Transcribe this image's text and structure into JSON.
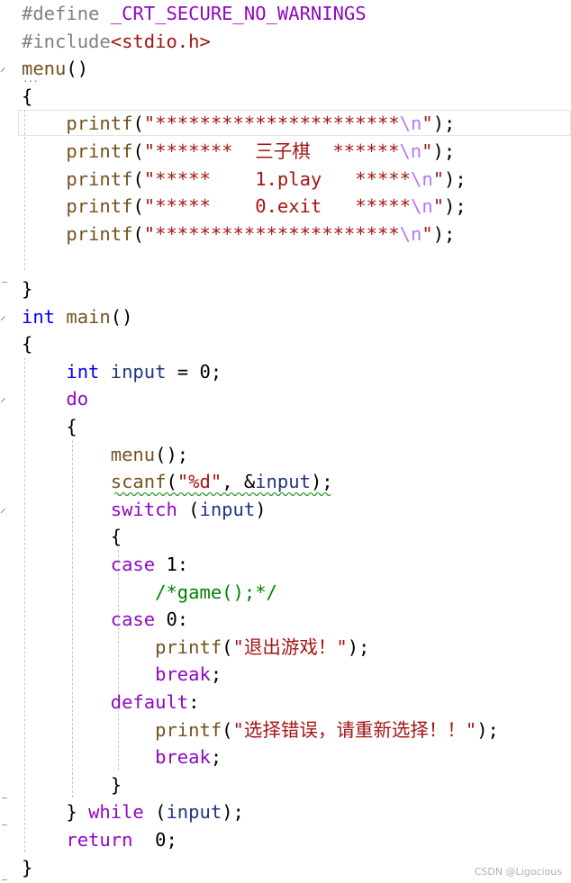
{
  "editor": {
    "colors": {
      "macro": "#808080",
      "keyword": "#0000ff",
      "control": "#8f08c4",
      "function": "#74531f",
      "string": "#a31515",
      "escape": "#b776fb",
      "comment": "#008000",
      "variable": "#1f377f",
      "default": "#000000"
    },
    "lines": [
      [
        {
          "t": "#define ",
          "c": "macro"
        },
        {
          "t": "_CRT_SECURE_NO_WARNINGS",
          "c": "control"
        }
      ],
      [
        {
          "t": "#include",
          "c": "macro"
        },
        {
          "t": "<stdio.h>",
          "c": "string"
        }
      ],
      [
        {
          "t": "menu",
          "c": "function"
        },
        {
          "t": "()",
          "c": "default"
        }
      ],
      [
        {
          "t": "{",
          "c": "default"
        }
      ],
      [
        {
          "t": "    ",
          "c": "default"
        },
        {
          "t": "printf",
          "c": "function"
        },
        {
          "t": "(",
          "c": "default"
        },
        {
          "t": "\"**********************",
          "c": "string"
        },
        {
          "t": "\\n",
          "c": "escape"
        },
        {
          "t": "\"",
          "c": "string"
        },
        {
          "t": ");",
          "c": "default"
        }
      ],
      [
        {
          "t": "    ",
          "c": "default"
        },
        {
          "t": "printf",
          "c": "function"
        },
        {
          "t": "(",
          "c": "default"
        },
        {
          "t": "\"*******  三子棋  ******",
          "c": "string"
        },
        {
          "t": "\\n",
          "c": "escape"
        },
        {
          "t": "\"",
          "c": "string"
        },
        {
          "t": ");",
          "c": "default"
        }
      ],
      [
        {
          "t": "    ",
          "c": "default"
        },
        {
          "t": "printf",
          "c": "function"
        },
        {
          "t": "(",
          "c": "default"
        },
        {
          "t": "\"*****    1.play   *****",
          "c": "string"
        },
        {
          "t": "\\n",
          "c": "escape"
        },
        {
          "t": "\"",
          "c": "string"
        },
        {
          "t": ");",
          "c": "default"
        }
      ],
      [
        {
          "t": "    ",
          "c": "default"
        },
        {
          "t": "printf",
          "c": "function"
        },
        {
          "t": "(",
          "c": "default"
        },
        {
          "t": "\"*****    0.exit   *****",
          "c": "string"
        },
        {
          "t": "\\n",
          "c": "escape"
        },
        {
          "t": "\"",
          "c": "string"
        },
        {
          "t": ");",
          "c": "default"
        }
      ],
      [
        {
          "t": "    ",
          "c": "default"
        },
        {
          "t": "printf",
          "c": "function"
        },
        {
          "t": "(",
          "c": "default"
        },
        {
          "t": "\"**********************",
          "c": "string"
        },
        {
          "t": "\\n",
          "c": "escape"
        },
        {
          "t": "\"",
          "c": "string"
        },
        {
          "t": ");",
          "c": "default"
        }
      ],
      [],
      [
        {
          "t": "}",
          "c": "default"
        }
      ],
      [
        {
          "t": "int",
          "c": "keyword"
        },
        {
          "t": " ",
          "c": "default"
        },
        {
          "t": "main",
          "c": "function"
        },
        {
          "t": "()",
          "c": "default"
        }
      ],
      [
        {
          "t": "{",
          "c": "default"
        }
      ],
      [
        {
          "t": "    ",
          "c": "default"
        },
        {
          "t": "int",
          "c": "keyword"
        },
        {
          "t": " ",
          "c": "default"
        },
        {
          "t": "input",
          "c": "variable"
        },
        {
          "t": " = 0;",
          "c": "default"
        }
      ],
      [
        {
          "t": "    ",
          "c": "default"
        },
        {
          "t": "do",
          "c": "control"
        }
      ],
      [
        {
          "t": "    {",
          "c": "default"
        }
      ],
      [
        {
          "t": "        ",
          "c": "default"
        },
        {
          "t": "menu",
          "c": "function"
        },
        {
          "t": "();",
          "c": "default"
        }
      ],
      [
        {
          "t": "        ",
          "c": "default"
        },
        {
          "t": "scanf",
          "c": "function"
        },
        {
          "t": "(",
          "c": "default"
        },
        {
          "t": "\"%d\"",
          "c": "string"
        },
        {
          "t": ", &",
          "c": "default"
        },
        {
          "t": "input",
          "c": "variable"
        },
        {
          "t": ");",
          "c": "default"
        }
      ],
      [
        {
          "t": "        ",
          "c": "default"
        },
        {
          "t": "switch",
          "c": "control"
        },
        {
          "t": " (",
          "c": "default"
        },
        {
          "t": "input",
          "c": "variable"
        },
        {
          "t": ")",
          "c": "default"
        }
      ],
      [
        {
          "t": "        {",
          "c": "default"
        }
      ],
      [
        {
          "t": "        ",
          "c": "default"
        },
        {
          "t": "case",
          "c": "control"
        },
        {
          "t": " 1:",
          "c": "default"
        }
      ],
      [
        {
          "t": "            ",
          "c": "default"
        },
        {
          "t": "/*game();*/",
          "c": "comment"
        }
      ],
      [
        {
          "t": "        ",
          "c": "default"
        },
        {
          "t": "case",
          "c": "control"
        },
        {
          "t": " 0:",
          "c": "default"
        }
      ],
      [
        {
          "t": "            ",
          "c": "default"
        },
        {
          "t": "printf",
          "c": "function"
        },
        {
          "t": "(",
          "c": "default"
        },
        {
          "t": "\"退出游戏！\"",
          "c": "string"
        },
        {
          "t": ");",
          "c": "default"
        }
      ],
      [
        {
          "t": "            ",
          "c": "default"
        },
        {
          "t": "break",
          "c": "control"
        },
        {
          "t": ";",
          "c": "default"
        }
      ],
      [
        {
          "t": "        ",
          "c": "default"
        },
        {
          "t": "default",
          "c": "control"
        },
        {
          "t": ":",
          "c": "default"
        }
      ],
      [
        {
          "t": "            ",
          "c": "default"
        },
        {
          "t": "printf",
          "c": "function"
        },
        {
          "t": "(",
          "c": "default"
        },
        {
          "t": "\"选择错误，请重新选择！！\"",
          "c": "string"
        },
        {
          "t": ");",
          "c": "default"
        }
      ],
      [
        {
          "t": "            ",
          "c": "default"
        },
        {
          "t": "break",
          "c": "control"
        },
        {
          "t": ";",
          "c": "default"
        }
      ],
      [
        {
          "t": "        }",
          "c": "default"
        }
      ],
      [
        {
          "t": "    } ",
          "c": "default"
        },
        {
          "t": "while",
          "c": "control"
        },
        {
          "t": " (",
          "c": "default"
        },
        {
          "t": "input",
          "c": "variable"
        },
        {
          "t": ");",
          "c": "default"
        }
      ],
      [
        {
          "t": "    ",
          "c": "default"
        },
        {
          "t": "return",
          "c": "control"
        },
        {
          "t": "  0;",
          "c": "default"
        }
      ],
      [
        {
          "t": "}",
          "c": "default"
        }
      ]
    ],
    "fold_markers": [
      {
        "line": 2,
        "icon": "chevron-icon"
      },
      {
        "line": 11,
        "icon": "chevron-icon"
      },
      {
        "line": 14,
        "icon": "chevron-icon"
      },
      {
        "line": 18,
        "icon": "chevron-icon"
      }
    ]
  },
  "watermark": "CSDN @Ligocious"
}
